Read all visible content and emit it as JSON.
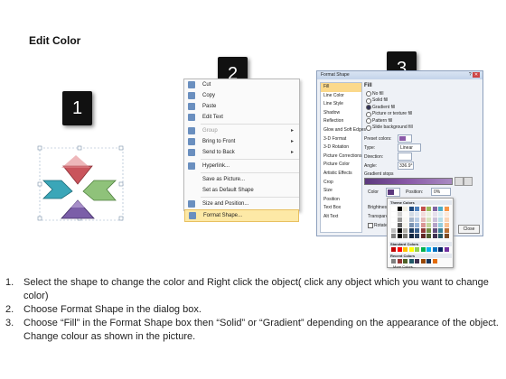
{
  "title": "Edit Color",
  "step_numbers": [
    "1",
    "2",
    "3"
  ],
  "context_menu": {
    "items": [
      {
        "label": "Cut",
        "icon": "scissors-icon",
        "disabled": false,
        "submenu": false
      },
      {
        "label": "Copy",
        "icon": "copy-icon",
        "disabled": false,
        "submenu": false
      },
      {
        "label": "Paste",
        "icon": "paste-icon",
        "disabled": false,
        "submenu": false
      },
      {
        "label": "Edit Text",
        "icon": "edit-text-icon",
        "disabled": false,
        "submenu": false
      },
      {
        "label": "Group",
        "icon": "group-icon",
        "disabled": true,
        "submenu": true
      },
      {
        "label": "Bring to Front",
        "icon": "bring-front-icon",
        "disabled": false,
        "submenu": true
      },
      {
        "label": "Send to Back",
        "icon": "send-back-icon",
        "disabled": false,
        "submenu": true
      },
      {
        "label": "Hyperlink...",
        "icon": "hyperlink-icon",
        "disabled": false,
        "submenu": false
      },
      {
        "label": "Save as Picture...",
        "icon": "",
        "disabled": false,
        "submenu": false
      },
      {
        "label": "Set as Default Shape",
        "icon": "",
        "disabled": false,
        "submenu": false
      },
      {
        "label": "Size and Position...",
        "icon": "size-icon",
        "disabled": false,
        "submenu": false
      },
      {
        "label": "Format Shape...",
        "icon": "format-shape-icon",
        "disabled": false,
        "submenu": false,
        "highlighted": true
      }
    ]
  },
  "format_dialog": {
    "title": "Format Shape",
    "nav_items": [
      "Fill",
      "Line Color",
      "Line Style",
      "Shadow",
      "Reflection",
      "Glow and Soft Edges",
      "3-D Format",
      "3-D Rotation",
      "Picture Corrections",
      "Picture Color",
      "Artistic Effects",
      "Crop",
      "Size",
      "Position",
      "Text Box",
      "Alt Text"
    ],
    "selected_nav": "Fill",
    "section_title": "Fill",
    "fill_options": [
      "No fill",
      "Solid fill",
      "Gradient fill",
      "Picture or texture fill",
      "Pattern fill",
      "Slide background fill"
    ],
    "selected_fill": "Gradient fill",
    "preset_colors_label": "Preset colors:",
    "type_label": "Type:",
    "type_value": "Linear",
    "direction_label": "Direction:",
    "angle_label": "Angle:",
    "angle_value": "336.9°",
    "gradient_stops_label": "Gradient stops",
    "color_label": "Color",
    "position_label": "Position:",
    "position_value": "0%",
    "brightness_label": "Brightness:",
    "transparency_label": "Transparen",
    "rotate_label": "Rotate",
    "close_label": "Close"
  },
  "color_palette": {
    "theme_label": "Theme Colors",
    "standard_label": "Standard Colors",
    "recent_label": "Recent Colors",
    "more_label": "More Colors...",
    "theme_top": [
      "#ffffff",
      "#000000",
      "#eeece1",
      "#1f497d",
      "#4f81bd",
      "#c0504d",
      "#9bbb59",
      "#8064a2",
      "#4bacc6",
      "#f79646"
    ],
    "standard": [
      "#c00000",
      "#ff0000",
      "#ffc000",
      "#ffff00",
      "#92d050",
      "#00b050",
      "#00b0f0",
      "#0070c0",
      "#002060",
      "#7030a0"
    ],
    "recent": [
      "#7f7f7f",
      "#953735",
      "#4f6228",
      "#205867",
      "#3f3151",
      "#984807",
      "#17365d",
      "#e36c09"
    ]
  },
  "instructions": [
    {
      "n": "1.",
      "text": "Select the shape to change the color and Right click the object( click any object which you want to change color)"
    },
    {
      "n": "2.",
      "text": "Choose Format Shape in the dialog box."
    },
    {
      "n": "3.",
      "text": "Choose “Fill” in the Format Shape box then “Solid” or “Gradient” depending on the appearance of the object. Change colour as shown in the picture."
    }
  ],
  "colors": {
    "arrow_red": "#c9545c",
    "arrow_teal": "#3aa6b8",
    "arrow_green": "#8fc27a",
    "arrow_purple": "#7b5ea8",
    "highlight": "#fde9a6",
    "gradient_bar": "#8a5aa8"
  }
}
